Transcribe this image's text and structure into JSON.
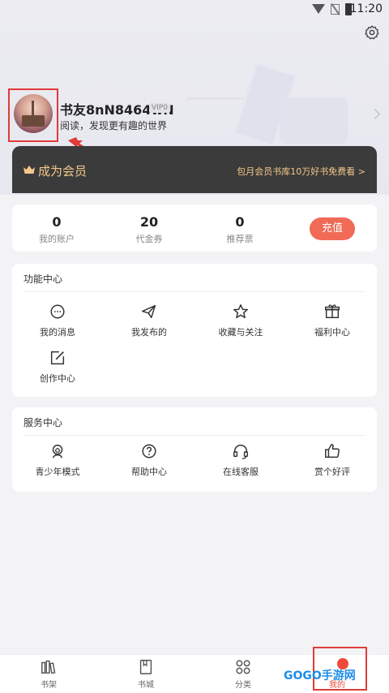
{
  "status_bar": {
    "time": "11:20"
  },
  "profile": {
    "username": "书友8nN8464wN",
    "vip_tag": "VIP0",
    "slogan": "阅读，发现更有趣的世界"
  },
  "vip_banner": {
    "title": "成为会员",
    "subtitle": "包月会员书库10万好书免费看 >"
  },
  "account": {
    "stats": [
      {
        "value": "0",
        "label": "我的账户"
      },
      {
        "value": "20",
        "label": "代金券"
      },
      {
        "value": "0",
        "label": "推荐票"
      }
    ],
    "recharge_label": "充值"
  },
  "function_center": {
    "title": "功能中心",
    "items": [
      {
        "label": "我的消息",
        "icon": "message-icon"
      },
      {
        "label": "我发布的",
        "icon": "send-icon"
      },
      {
        "label": "收藏与关注",
        "icon": "star-icon"
      },
      {
        "label": "福利中心",
        "icon": "gift-icon"
      },
      {
        "label": "创作中心",
        "icon": "edit-icon"
      }
    ]
  },
  "service_center": {
    "title": "服务中心",
    "items": [
      {
        "label": "青少年模式",
        "icon": "teen-icon"
      },
      {
        "label": "帮助中心",
        "icon": "help-icon"
      },
      {
        "label": "在线客服",
        "icon": "headset-icon"
      },
      {
        "label": "赏个好评",
        "icon": "thumbs-up-icon"
      }
    ]
  },
  "bottom_nav": {
    "items": [
      {
        "label": "书架",
        "icon": "bookshelf-icon"
      },
      {
        "label": "书城",
        "icon": "bookstore-icon"
      },
      {
        "label": "分类",
        "icon": "category-icon"
      },
      {
        "label": "我的",
        "icon": "me-icon"
      }
    ]
  },
  "watermark": "GOGO手游网",
  "colors": {
    "accent": "#f06a56",
    "vip_gold": "#f5c98a",
    "vip_bg": "#3b3b3b",
    "highlight": "#e03a3a"
  }
}
